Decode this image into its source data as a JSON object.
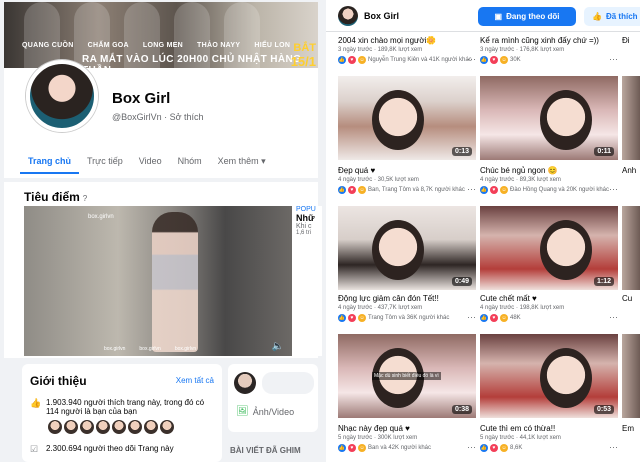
{
  "left": {
    "cover": {
      "names": [
        "QUANG CUỒN",
        "CHẤM GOA",
        "LONG MEN",
        "THẢO NAYY",
        "HIẾU LON"
      ],
      "headline": "RA MẮT VÀO LÚC 20H00 CHỦ NHẬT HÀNG TUẦN",
      "badge": "BẮT",
      "date": "15/1"
    },
    "page_name": "Box Girl",
    "handle": "@BoxGirlVn · Sở thích",
    "tabs": [
      "Trang chủ",
      "Trực tiếp",
      "Video",
      "Nhóm",
      "Xem thêm ▾"
    ],
    "featured": {
      "title": "Tiêu điểm",
      "q": "?",
      "watermark": "box.girlvn",
      "logos": [
        "box.girlvn",
        "box.girlvn",
        "box.girlvn"
      ],
      "side_lines": [
        "POPU",
        "Nhữ",
        "Khi c",
        "1,6 tri"
      ]
    },
    "intro": {
      "title": "Giới thiệu",
      "see_all": "Xem tất cả",
      "likes_line1": "1.903.940 người thích trang này, trong đó có",
      "likes_line2": "114 người là bạn của bạn",
      "followers": "2.300.694 người theo dõi Trang này"
    },
    "post": {
      "photo_video": "Ảnh/Video",
      "pinned": "BÀI VIẾT ĐÃ GHIM"
    }
  },
  "right": {
    "header": {
      "name": "Box Girl",
      "follow_btn": "Đang theo dõi",
      "liked_btn": "Đã thích"
    },
    "cards": [
      {
        "title": "2004 xin chào mọi người🌼",
        "meta": "3 ngày trước · 189,8K lượt xem",
        "react": "Nguyễn Trung Kiên và 41K người khác"
      },
      {
        "title": "Kể ra mình cũng xinh đấy chứ =))",
        "meta": "3 ngày trước · 176,8K lượt xem",
        "react": "30K"
      },
      {
        "title": "Đẹp quá ♥",
        "meta": "4 ngày trước · 30,5K lượt xem",
        "react": "Ban, Trang Tôm và 8,7K người khác",
        "dur": "0:13"
      },
      {
        "title": "Chúc bé ngủ ngon 😊",
        "meta": "4 ngày trước · 89,3K lượt xem",
        "react": "Đào Hồng Quang và 20K người khác",
        "dur": "0:11"
      },
      {
        "title": "Động lực giảm cân đón Tết!!",
        "meta": "4 ngày trước · 437,7K lượt xem",
        "react": "Trang Tôm và 36K người khác",
        "dur": "0:49"
      },
      {
        "title": "Cute chết mất ♥",
        "meta": "4 ngày trước · 198,8K lượt xem",
        "react": "48K",
        "dur": "1:12"
      },
      {
        "title": "Nhạc này đẹp quá ♥",
        "meta": "5 ngày trước · 300K lượt xem",
        "react": "Ban và 42K người khác",
        "dur": "0:38"
      },
      {
        "title": "Cute thì em có thừa!!",
        "meta": "5 ngày trước · 44,1K lượt xem",
        "react": "8,6K",
        "dur": "0:53"
      }
    ],
    "edge_titles": [
      "Đi",
      "Anh",
      "Cu",
      "Em"
    ],
    "overlay_text": "Mặc dù sinh biết điều đó là vì"
  }
}
